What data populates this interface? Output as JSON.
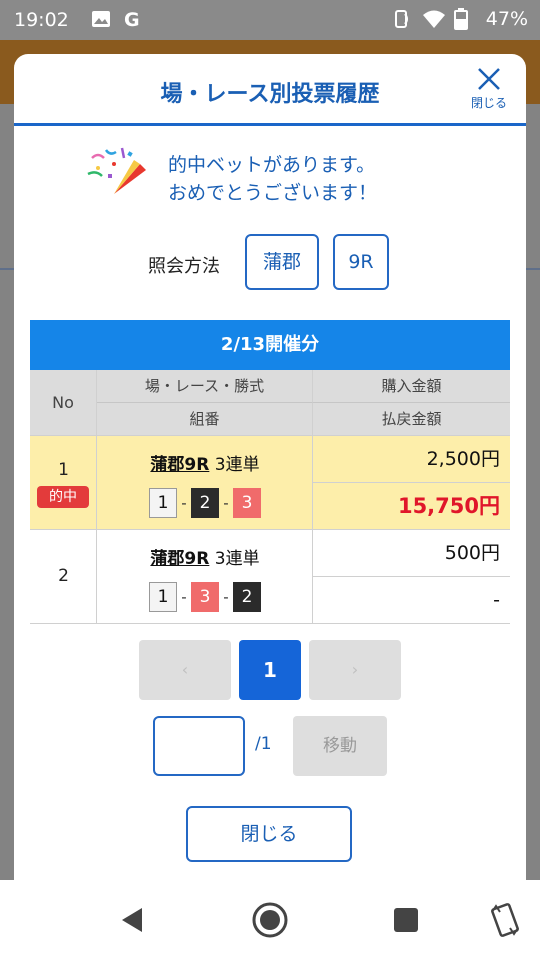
{
  "status_bar": {
    "time": "19:02",
    "battery": "47%"
  },
  "modal": {
    "title": "場・レース別投票履歴",
    "close_label": "閉じる",
    "congrats_line1": "的中ベットがあります。",
    "congrats_line2": "おめでとうございます！",
    "inquiry_label": "照会方法",
    "venue": "蒲郡",
    "race": "9R"
  },
  "table": {
    "header": "2/13開催分",
    "columns": {
      "no": "No",
      "venue_race_type": "場・レース・勝式",
      "combination": "組番",
      "purchase": "購入金額",
      "payout": "払戻金額"
    },
    "rows": [
      {
        "no": "1",
        "hit_badge": "的中",
        "race_link": "蒲郡9R",
        "bet_type": "3連単",
        "combo": [
          "1",
          "2",
          "3"
        ],
        "purchase": "2,500円",
        "payout": "15,750円"
      },
      {
        "no": "2",
        "race_link": "蒲郡9R",
        "bet_type": "3連単",
        "combo": [
          "1",
          "3",
          "2"
        ],
        "purchase": "500円",
        "payout": "-"
      }
    ]
  },
  "pager": {
    "prev": "‹",
    "current": "1",
    "next": "›",
    "input_value": "",
    "total": "/1",
    "move_label": "移動"
  },
  "footer": {
    "close_button": "閉じる"
  },
  "colors": {
    "accent": "#1565d8",
    "hit_row": "#fdeeaa",
    "payout_red": "#e0162a",
    "table_header": "#1585e8"
  }
}
